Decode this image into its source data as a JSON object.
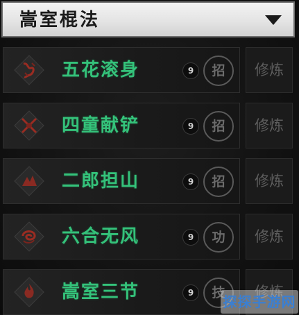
{
  "header": {
    "title": "嵩室棍法",
    "dropdown_icon": "triangle-down-icon"
  },
  "techniques": [
    {
      "name": "五花滚身",
      "level": "9",
      "type": "招",
      "action": "修炼",
      "icon": "dragon-emblem-icon"
    },
    {
      "name": "四童献铲",
      "level": "9",
      "type": "招",
      "action": "修炼",
      "icon": "crossed-weapons-icon"
    },
    {
      "name": "二郎担山",
      "level": "9",
      "type": "招",
      "action": "修炼",
      "icon": "mountain-emblem-icon"
    },
    {
      "name": "六合无风",
      "level": "9",
      "type": "功",
      "action": "修炼",
      "icon": "swirl-dragon-icon"
    },
    {
      "name": "嵩室三节",
      "level": "9",
      "type": "技",
      "action": "修炼",
      "icon": "flame-emblem-icon"
    }
  ],
  "watermark": "探探手游网",
  "colors": {
    "name_green": "#34c27a",
    "header_bg": "#e8e8e8",
    "icon_red": "#8a2a22"
  }
}
